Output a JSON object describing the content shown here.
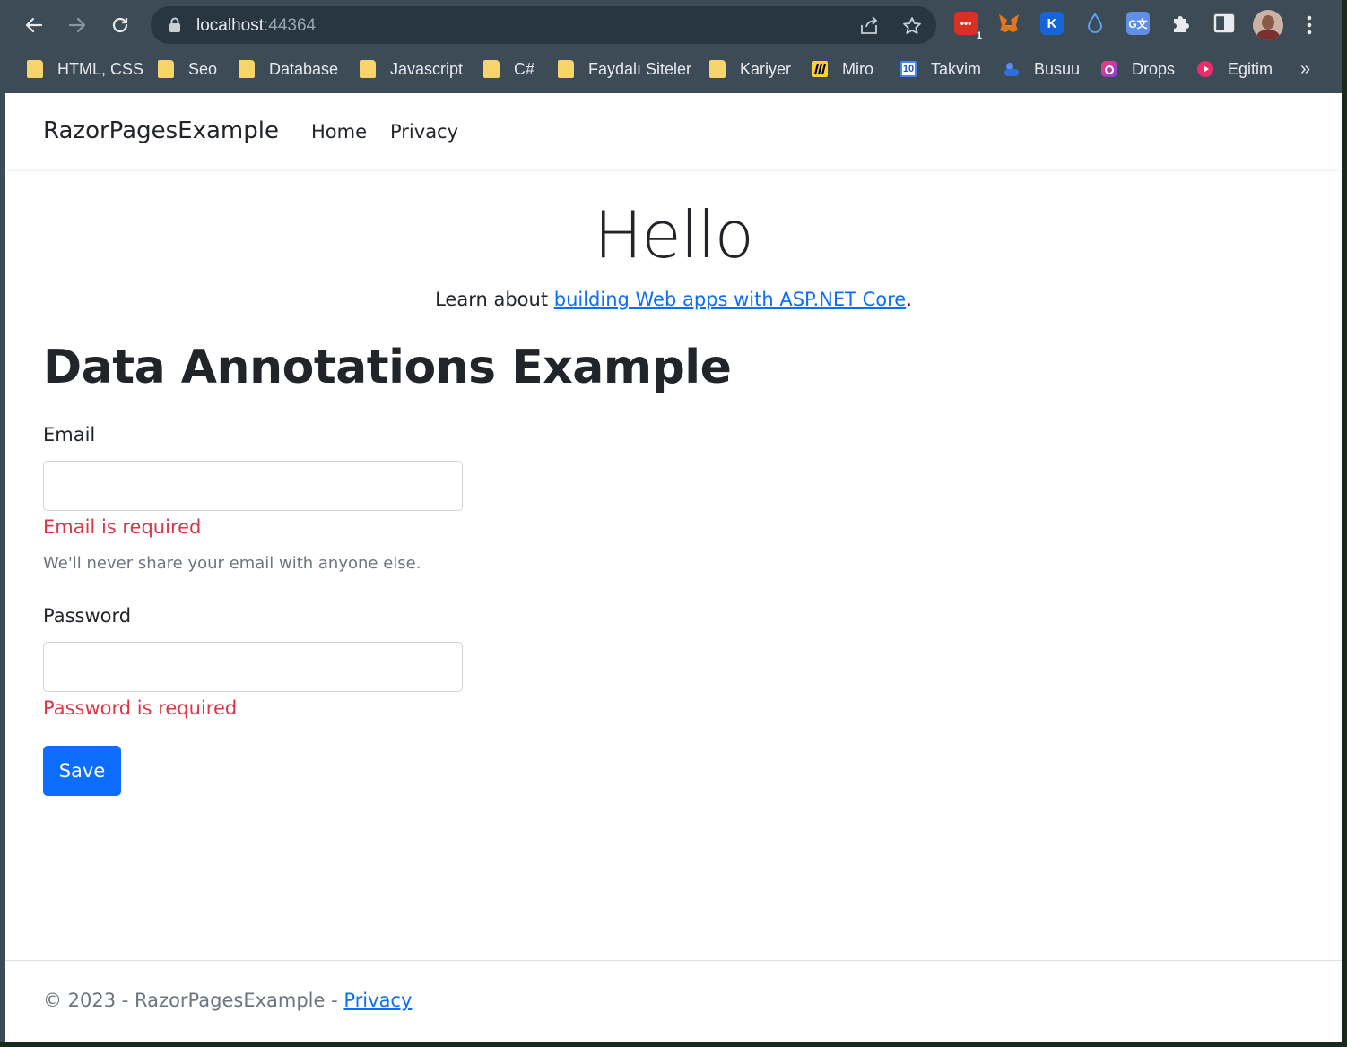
{
  "browser": {
    "url_host": "localhost",
    "url_port": ":44364",
    "bookmarks": [
      {
        "label": "HTML, CSS",
        "icon": "folder-icon"
      },
      {
        "label": "Seo",
        "icon": "folder-icon"
      },
      {
        "label": "Database",
        "icon": "folder-icon"
      },
      {
        "label": "Javascript",
        "icon": "folder-icon"
      },
      {
        "label": "C#",
        "icon": "folder-icon"
      },
      {
        "label": "Faydalı Siteler",
        "icon": "folder-icon"
      },
      {
        "label": "Kariyer",
        "icon": "folder-icon"
      },
      {
        "label": "Miro",
        "icon": "miro-icon"
      },
      {
        "label": "Takvim",
        "icon": "calendar-icon"
      },
      {
        "label": "Busuu",
        "icon": "busuu-icon"
      },
      {
        "label": "Drops",
        "icon": "drops-icon"
      },
      {
        "label": "Egitim",
        "icon": "play-icon"
      }
    ],
    "more": "»",
    "extension_badge": "1",
    "calendar_day": "10"
  },
  "navbar": {
    "brand": "RazorPagesExample",
    "links": [
      "Home",
      "Privacy"
    ]
  },
  "hero": {
    "title": "Hello",
    "learn_prefix": "Learn about ",
    "learn_link": "building Web apps with ASP.NET Core",
    "learn_suffix": "."
  },
  "form": {
    "heading": "Data Annotations Example",
    "email_label": "Email",
    "email_value": "",
    "email_error": "Email is required",
    "email_help": "We'll never share your email with anyone else.",
    "password_label": "Password",
    "password_value": "",
    "password_error": "Password is required",
    "save_label": "Save"
  },
  "footer": {
    "text": "© 2023 - RazorPagesExample - ",
    "link": "Privacy"
  },
  "colors": {
    "primary": "#0d6efd",
    "danger": "#dc3545",
    "muted": "#6c757d",
    "chrome_frame": "#3c4b56"
  }
}
